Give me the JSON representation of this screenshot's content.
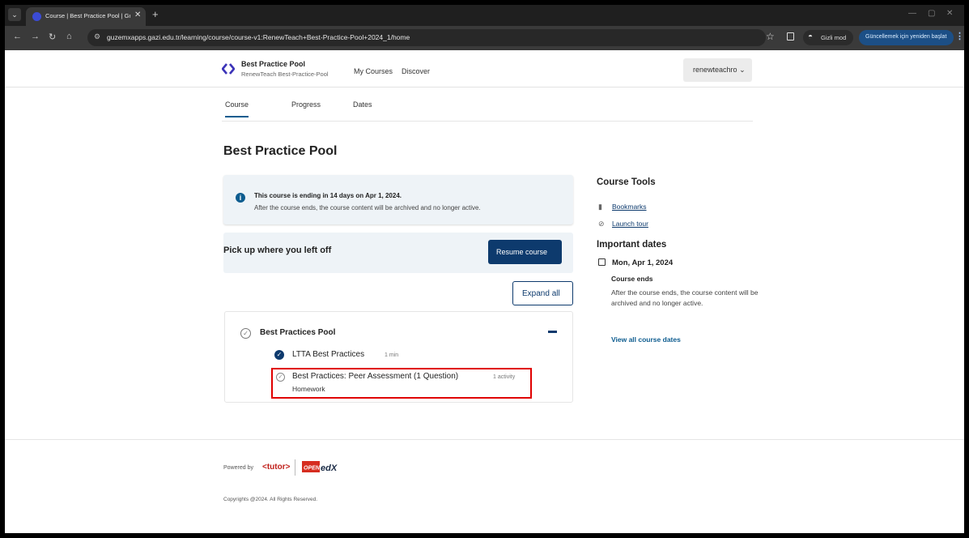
{
  "browser": {
    "tab_title": "Course | Best Practice Pool | Gu",
    "address": "guzemxapps.gazi.edu.tr/learning/course/course-v1:RenewTeach+Best-Practice-Pool+2024_1/home",
    "incognito_label": "Gizli mod",
    "update_label": "Güncellemek için yeniden başlat"
  },
  "header": {
    "title": "Best Practice Pool",
    "subtitle": "RenewTeach Best-Practice-Pool",
    "nav": [
      "My Courses",
      "Discover"
    ],
    "username": "renewteachro"
  },
  "course_tabs": [
    "Course",
    "Progress",
    "Dates"
  ],
  "page_title": "Best Practice Pool",
  "alert": {
    "bold": "This course is ending in 14 days on Apr 1, 2024.",
    "body": "After the course ends, the course content will be archived and no longer active."
  },
  "resume": {
    "text": "Pick up where you left off",
    "button": "Resume course"
  },
  "expand_all": "Expand all",
  "section": {
    "title": "Best Practices Pool",
    "items": [
      {
        "title": "LTTA Best Practices",
        "meta": "1 min",
        "completed": true
      },
      {
        "title": "Best Practices: Peer Assessment (1 Question)",
        "meta": "1 activity",
        "type": "Homework",
        "completed": false
      }
    ]
  },
  "course_tools": {
    "title": "Course Tools",
    "links": [
      "Bookmarks",
      "Launch tour"
    ]
  },
  "important_dates": {
    "title": "Important dates",
    "date": "Mon, Apr 1, 2024",
    "event_title": "Course ends",
    "event_body": "After the course ends, the course content will be archived and no longer active.",
    "view_all": "View all course dates"
  },
  "footer": {
    "powered_by": "Powered by",
    "tutor": "<tutor>",
    "openedx": "OPEN edX",
    "copyright": "Copyrights @2024. All Rights Reserved."
  },
  "colors": {
    "primary": "#0d3a6d",
    "highlight_box": "#e00000"
  }
}
